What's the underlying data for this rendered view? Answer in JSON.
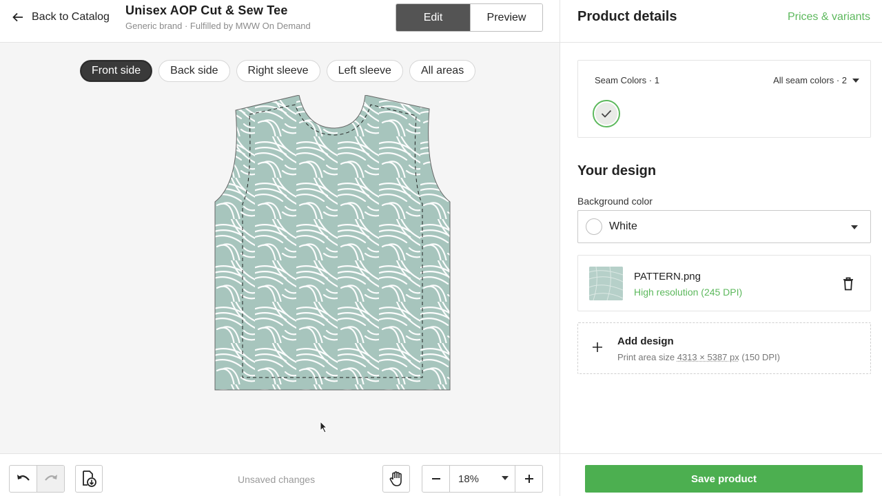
{
  "header": {
    "back_label": "Back to Catalog",
    "title": "Unisex AOP Cut & Sew Tee",
    "subtitle": "Generic brand · Fulfilled by MWW On Demand",
    "mode_edit": "Edit",
    "mode_preview": "Preview"
  },
  "side_tabs": [
    {
      "label": "Front side",
      "active": true
    },
    {
      "label": "Back side",
      "active": false
    },
    {
      "label": "Right sleeve",
      "active": false
    },
    {
      "label": "Left sleeve",
      "active": false
    },
    {
      "label": "All areas",
      "active": false
    }
  ],
  "toolbar": {
    "unsaved_label": "Unsaved changes",
    "zoom_value": "18%"
  },
  "panel": {
    "title": "Product details",
    "link": "Prices & variants",
    "seam": {
      "label": "Seam Colors · 1",
      "all_label": "All seam colors · 2"
    },
    "design_title": "Your design",
    "background": {
      "label": "Background color",
      "value": "White"
    },
    "file": {
      "name": "PATTERN.png",
      "resolution": "High resolution (245 DPI)"
    },
    "add_design": {
      "title": "Add design",
      "sub_prefix": "Print area size",
      "dimensions": "4313 × 5387 px",
      "dpi": "(150 DPI)"
    },
    "save_label": "Save product"
  },
  "colors": {
    "accent_green": "#4caf50",
    "link_green": "#5cb85c",
    "pattern_bg": "#a7c5bd"
  }
}
